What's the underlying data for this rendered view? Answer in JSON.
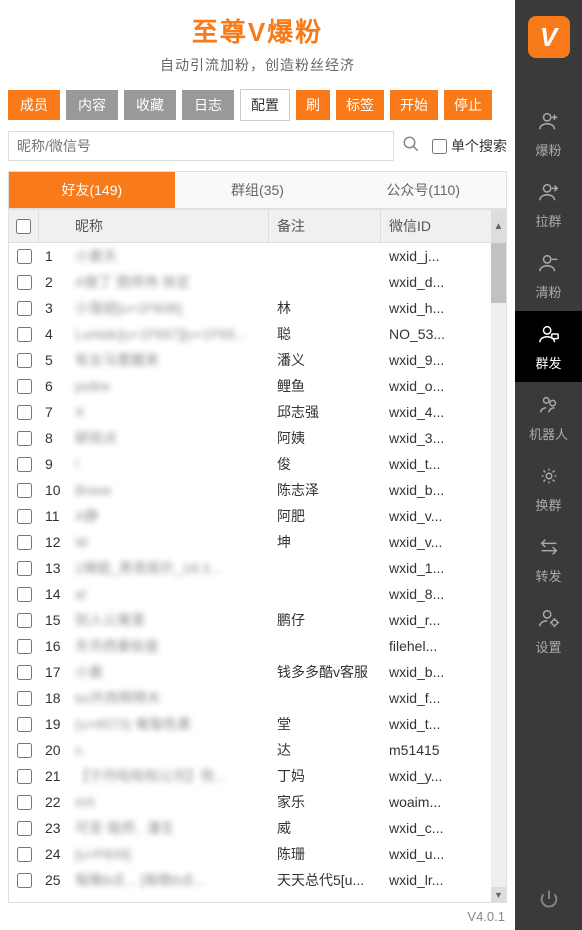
{
  "header": {
    "title": "至尊V爆粉",
    "subtitle": "自动引流加粉，创造粉丝经济"
  },
  "nav_tabs": {
    "members": "成员",
    "content": "内容",
    "favorites": "收藏",
    "logs": "日志"
  },
  "actions": {
    "config": "配置",
    "refresh": "刷",
    "tag": "标签",
    "start": "开始",
    "stop": "停止"
  },
  "search": {
    "placeholder": "昵称/微信号",
    "single_label": "单个搜索"
  },
  "list_tabs": {
    "friends": "好友(149)",
    "groups": "群组(35)",
    "officials": "公众号(110)"
  },
  "columns": {
    "nickname": "昵称",
    "remark": "备注",
    "wechat_id": "微信ID"
  },
  "rows": [
    {
      "num": "1",
      "nick": "小姜天",
      "remark": "",
      "id": "wxid_j..."
    },
    {
      "num": "2",
      "nick": "A做丁 图师伟 徐定",
      "remark": "",
      "id": "wxid_d..."
    },
    {
      "num": "3",
      "nick": "小笼妞[u+1F60B]",
      "remark": "林",
      "id": "wxid_h..."
    },
    {
      "num": "4",
      "nick": "Lunialc[u+1F697][u+1F69...",
      "remark": "聪",
      "id": "NO_53..."
    },
    {
      "num": "5",
      "nick": "有女马要醒来",
      "remark": "潘义",
      "id": "wxid_9..."
    },
    {
      "num": "6",
      "nick": "poltre",
      "remark": "鲤鱼",
      "id": "wxid_o..."
    },
    {
      "num": "7",
      "nick": "X",
      "remark": "邱志强",
      "id": "wxid_4..."
    },
    {
      "num": "8",
      "nick": "颖视点",
      "remark": "阿姨",
      "id": "wxid_3..."
    },
    {
      "num": "9",
      "nick": "!",
      "remark": "俊",
      "id": "wxid_t..."
    },
    {
      "num": "10",
      "nick": "Brave",
      "remark": "陈志泽",
      "id": "wxid_b..."
    },
    {
      "num": "11",
      "nick": "A静",
      "remark": "阿肥",
      "id": "wxid_v..."
    },
    {
      "num": "12",
      "nick": "W",
      "remark": "坤",
      "id": "wxid_v..."
    },
    {
      "num": "13",
      "nick": "1辣姐_黑夜底价_18:3...",
      "remark": "",
      "id": "wxid_1..."
    },
    {
      "num": "14",
      "nick": "a!",
      "remark": "",
      "id": "wxid_8..."
    },
    {
      "num": "15",
      "nick": "别人公寓里",
      "remark": "鹏仔",
      "id": "wxid_r..."
    },
    {
      "num": "16",
      "nick": "东市西秦始皇",
      "remark": "",
      "id": "filehel..."
    },
    {
      "num": "17",
      "nick": "小姜",
      "remark": "钱多多酷v客服",
      "id": "wxid_b..."
    },
    {
      "num": "18",
      "nick": "to!开西啊啊木",
      "remark": "",
      "id": "wxid_f..."
    },
    {
      "num": "19",
      "nick": "(u+6573) 匍匐色素",
      "remark": "堂",
      "id": "wxid_t..."
    },
    {
      "num": "20",
      "nick": "c.",
      "remark": "达",
      "id": "m51415"
    },
    {
      "num": "21",
      "nick": "【宁丹啦啦啦公司】陈...",
      "remark": "丁妈",
      "id": "wxid_y..."
    },
    {
      "num": "22",
      "nick": "m!t",
      "remark": "家乐",
      "id": "woaim..."
    },
    {
      "num": "23",
      "nick": "可圣 哉师.. 潘生",
      "remark": "威",
      "id": "wxid_c..."
    },
    {
      "num": "24",
      "nick": "[u+F609]",
      "remark": "陈珊",
      "id": "wxid_u..."
    },
    {
      "num": "25",
      "nick": "每晚8点... ]每晚8点...",
      "remark": "天天总代5[u...",
      "id": "wxid_lr..."
    }
  ],
  "footer": {
    "version": "V4.0.1"
  },
  "sidebar": {
    "baofen": "爆粉",
    "laqun": "拉群",
    "qingfen": "清粉",
    "qunfa": "群发",
    "robot": "机器人",
    "huanqun": "换群",
    "zhuanfa": "转发",
    "settings": "设置"
  }
}
